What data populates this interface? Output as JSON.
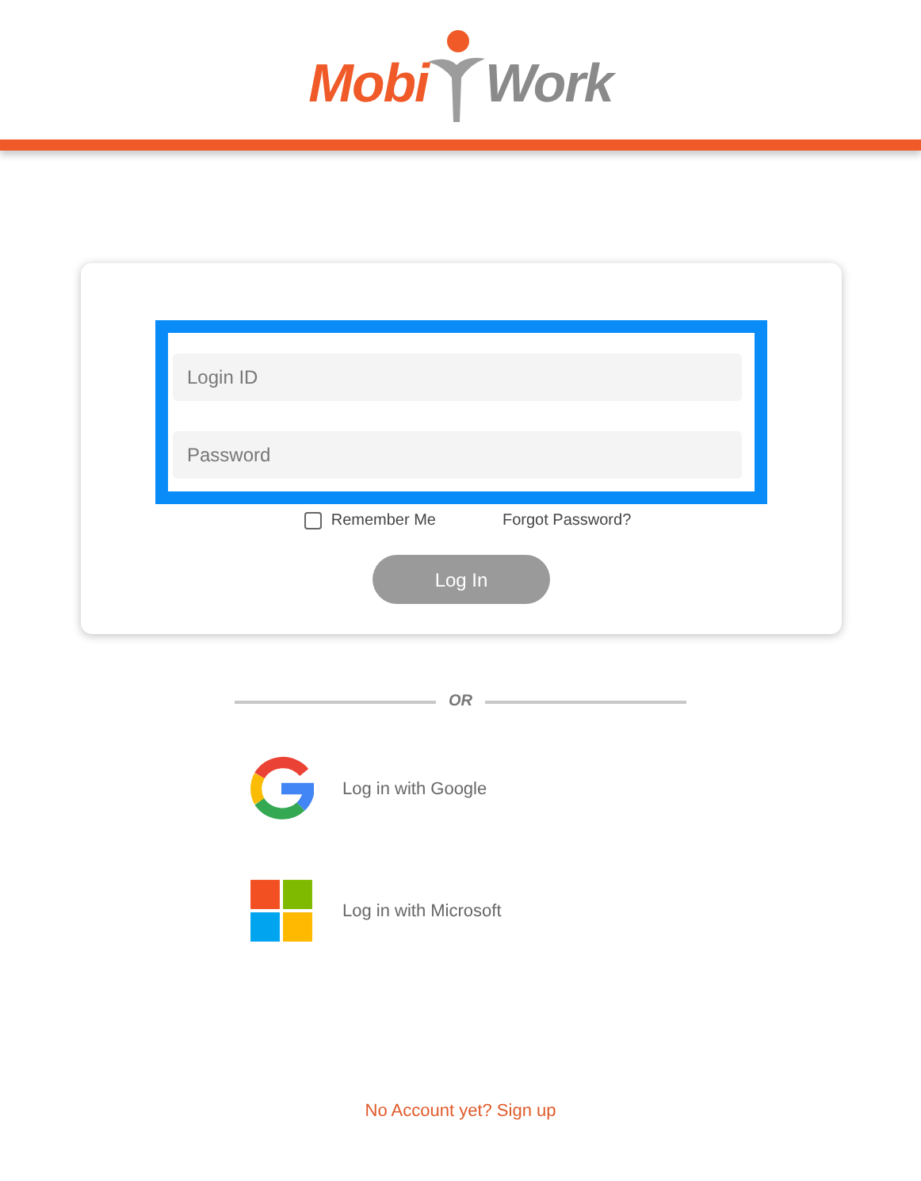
{
  "logo": {
    "left": "Mobi",
    "right": "Work"
  },
  "form": {
    "fields": [
      {
        "placeholder": "Login ID"
      },
      {
        "placeholder": "Password"
      }
    ],
    "remember": {
      "label": "Remember Me",
      "checked": false
    },
    "forgot": "Forgot Password?",
    "submit": "Log In"
  },
  "divider": "OR",
  "providers": [
    {
      "kind": "google",
      "label": "Log in with Google"
    },
    {
      "kind": "microsoft",
      "label": "Log in with Microsoft"
    }
  ],
  "signup": "No Account yet? Sign up"
}
